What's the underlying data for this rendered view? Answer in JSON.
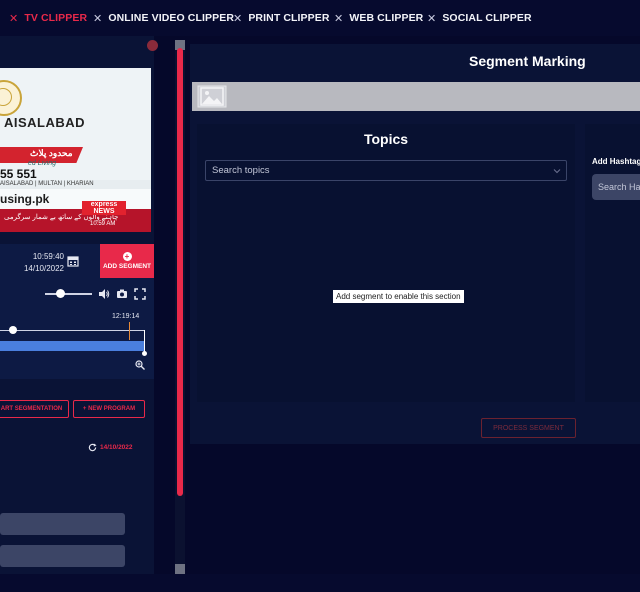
{
  "nav": {
    "items": [
      {
        "label": "TV CLIPPER",
        "active": true
      },
      {
        "label": "ONLINE VIDEO CLIPPER",
        "active": false
      },
      {
        "label": "PRINT CLIPPER",
        "active": false
      },
      {
        "label": "WEB CLIPPER",
        "active": false
      },
      {
        "label": "SOCIAL CLIPPER",
        "active": false
      }
    ],
    "separator": "✕"
  },
  "video": {
    "city": "AISALABAD",
    "banner_urdu": "محدود پلاٹ",
    "subtitle": "ed Living",
    "phone": "55 551",
    "strip": "AISALABAD  |  MULTAN  |  KHARIAN",
    "website": "using.pk",
    "ticker": "چاہنے والوں کے ساتھ بے شمار سرگرمی",
    "channel_logo": "express NEWS",
    "channel_time": "10:59 AM"
  },
  "player": {
    "time": "10:59:40",
    "date": "14/10/2022",
    "add_segment_label": "ADD SEGMENT",
    "timeline_end": "12:19:14",
    "volume_level": 0.3
  },
  "actions": {
    "start_segmentation": "ART SEGMENTATION",
    "new_program": "+ NEW PROGRAM",
    "refresh_date": "14/10/2022"
  },
  "main": {
    "title": "Segment Marking",
    "topics": {
      "title": "Topics",
      "search_placeholder": "Search topics",
      "hint": "Add segment to enable this section"
    },
    "hashtags": {
      "label": "Add Hashtag",
      "placeholder": "Search Ha"
    },
    "process_button": "PROCESS SEGMENT"
  },
  "colors": {
    "accent": "#e8294a",
    "background": "#05082a",
    "panel": "#0a1336",
    "timeline_blue": "#4a7fde"
  }
}
